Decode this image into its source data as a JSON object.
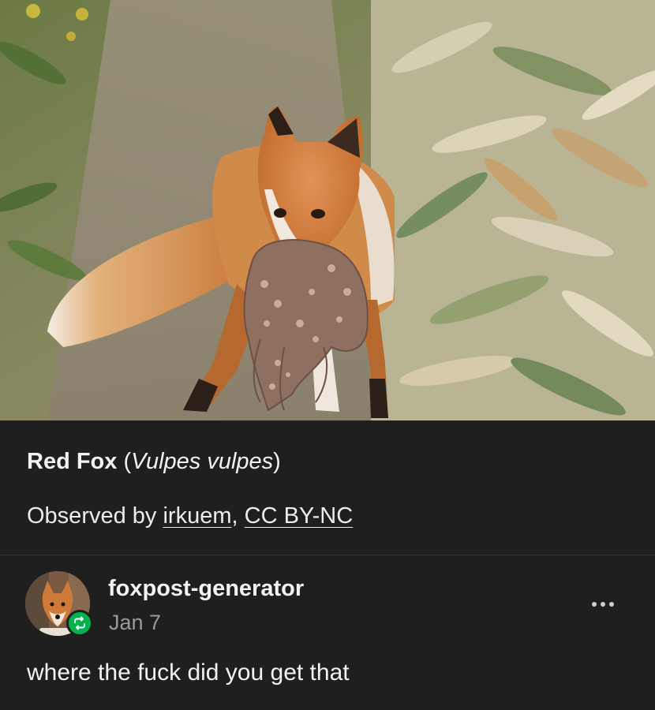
{
  "photo": {
    "subject_icon": "fox-photo"
  },
  "caption": {
    "common_name": "Red Fox",
    "scientific_prefix": " (",
    "scientific_name": "Vulpes vulpes",
    "scientific_suffix": ")",
    "observed_prefix": "Observed by ",
    "observer": "irkuem",
    "separator": ", ",
    "license": "CC BY-NC"
  },
  "reblog": {
    "avatar_icon": "fox-avatar-icon",
    "badge_icon": "reblog-icon",
    "badge_color": "#00b34a",
    "username": "foxpost-generator",
    "date": "Jan 7",
    "more_icon": "ellipsis-icon",
    "comment": "where the fuck did you get that"
  },
  "colors": {
    "background": "#1f1f1f",
    "text": "#f2f2f2",
    "muted_text": "#9a9a9a"
  }
}
